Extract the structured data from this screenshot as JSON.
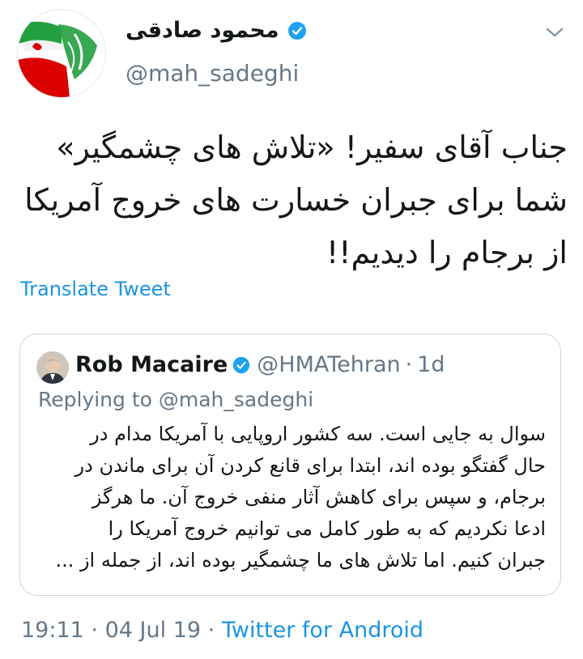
{
  "author": {
    "display_name": "محمود صادقی",
    "handle": "@mah_sadeghi",
    "verified": true
  },
  "tweet": {
    "lines": [
      "جناب آقای سفیر! «تلاش های چشمگیر»",
      "شما برای جبران خسارت های خروج آمریکا",
      "از برجام را دیدیم!!"
    ],
    "translate_label": "Translate Tweet"
  },
  "quoted_tweet": {
    "name": "Rob Macaire",
    "handle": "@HMATehran",
    "separator": "·",
    "time": "1d",
    "replying_to": "Replying to @mah_sadeghi",
    "lines": [
      "سوال به جایی است. سه کشور اروپایی با آمریکا مدام در",
      "حال گفتگو بوده اند، ابتدا برای قانع کردن آن برای ماندن در",
      "برجام، و سپس برای کاهش آثار منفی خروج آن. ما هرگز",
      "ادعا نکردیم که به طور کامل می توانیم خروج آمریکا را",
      "جبران کنیم. اما تلاش های ما چشمگیر بوده اند، از جمله از ..."
    ]
  },
  "footer": {
    "time": "19:11",
    "sep1": "·",
    "date": "04 Jul 19",
    "sep2": "·",
    "source": "Twitter for Android"
  },
  "colors": {
    "link": "#1b95e0",
    "secondary_text": "#657786",
    "border": "#ccd6dd",
    "verified": "#1da1f2"
  },
  "icons": [
    "verified-badge-icon",
    "chevron-down-icon"
  ]
}
